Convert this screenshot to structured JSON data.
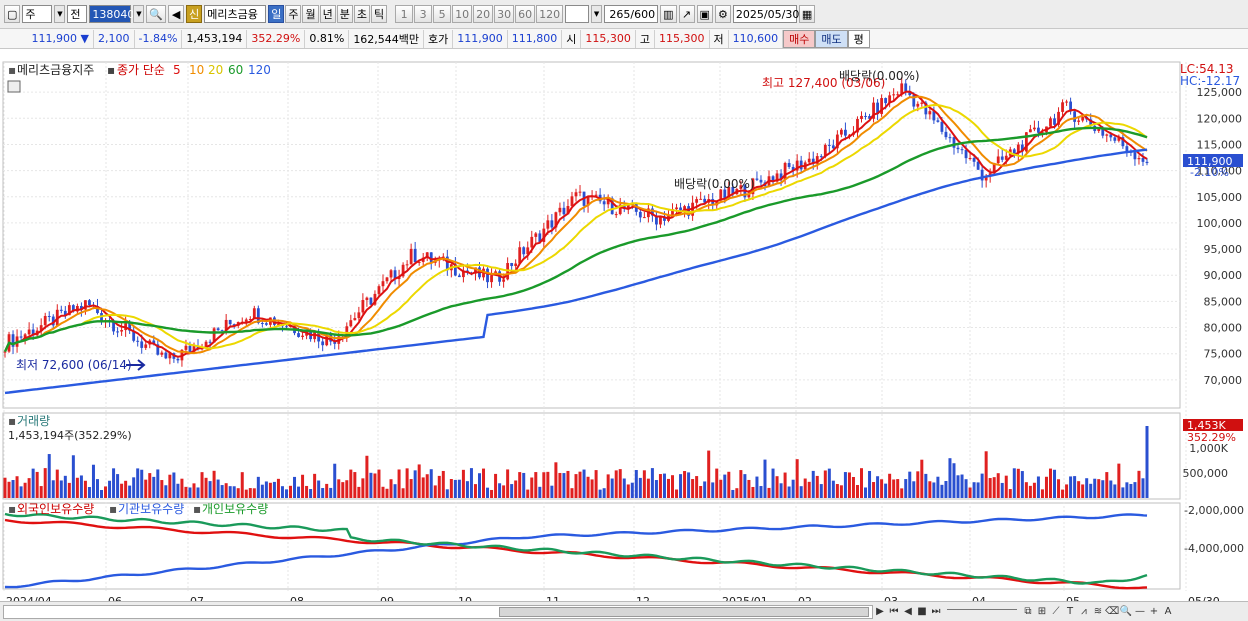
{
  "toolbar": {
    "market": "주",
    "prefix": "전",
    "code": "138040",
    "sin": "신",
    "name": "메리츠금융",
    "periods": [
      "일",
      "주",
      "월",
      "년",
      "분",
      "초",
      "틱"
    ],
    "active_period": "일",
    "intervals": [
      "1",
      "3",
      "5",
      "10",
      "20",
      "30",
      "60",
      "120"
    ],
    "count": "265",
    "max_count": "/600",
    "date": "2025/05/30"
  },
  "info": {
    "price": "111,900",
    "arrow": "▼",
    "change": "2,100",
    "change_pct": "-1.84%",
    "volume": "1,453,194",
    "vol_ratio": "352.29%",
    "turnover_ratio": "0.81%",
    "amount": "162,544백만",
    "quote_label": "호가",
    "ask": "111,900",
    "bid": "111,800",
    "open_label": "시",
    "open": "115,300",
    "high_label": "고",
    "high": "115,300",
    "low_label": "저",
    "low": "110,600",
    "buy": "매수",
    "sell": "매도",
    "avg": "평"
  },
  "chart_labels": {
    "name_tag": "메리츠금융지주",
    "ma_prefix": "종가 단순",
    "ma_periods": [
      "5",
      "10",
      "20",
      "60",
      "120"
    ],
    "ma_colors": [
      "#dd1111",
      "#f08c00",
      "#ecd800",
      "#1a9a2a",
      "#2a5ae0"
    ],
    "lc": "LC:54.13",
    "hc": "HC:-12.17",
    "price_tag": "111,900",
    "price_pct": "-2.10%",
    "high_note": "최고 127,400 (03/06)",
    "low_note": "최저 72,600 (06/14)",
    "div_note1": "배당락(0.00%)",
    "div_note2": "배당락(0.00%)",
    "vol_title": "거래량",
    "vol_value": "1,453,194주(352.29%)",
    "vol_tag": "1,453K",
    "vol_tag_pct": "352.29%",
    "holder_labels": [
      "외국인보유수량",
      "기관보유수량",
      "개인보유수량"
    ]
  },
  "chart_data": {
    "type": "line",
    "price_axis": [
      "125,000",
      "120,000",
      "115,000",
      "110,000",
      "105,000",
      "100,000",
      "95,000",
      "90,000",
      "85,000",
      "80,000",
      "75,000",
      "70,000"
    ],
    "price_range": [
      65000,
      130000
    ],
    "volume_axis": [
      "1,000K",
      "500,000"
    ],
    "holder_axis": [
      "-2,000,000",
      "-4,000,000"
    ],
    "x_labels": [
      "2024/04",
      "06",
      "07",
      "08",
      "09",
      "10",
      "11",
      "12",
      "2025/01",
      "02",
      "03",
      "04",
      "05",
      "05/30"
    ],
    "close_points": [
      [
        "2024/04",
        77000
      ],
      [
        "2024/05",
        84500
      ],
      [
        "2024/06",
        73500
      ],
      [
        "2024/07",
        83000
      ],
      [
        "2024/08",
        77500
      ],
      [
        "2024/09",
        94000
      ],
      [
        "2024/10",
        89000
      ],
      [
        "2024/11",
        105000
      ],
      [
        "2024/12",
        101000
      ],
      [
        "2025/01",
        106000
      ],
      [
        "2025/02",
        113000
      ],
      [
        "2025/03",
        126000
      ],
      [
        "2025/04",
        109000
      ],
      [
        "2025/05",
        122000
      ],
      [
        "2025/05/30",
        111900
      ]
    ],
    "series": [
      {
        "name": "5",
        "color": "#dd1111"
      },
      {
        "name": "10",
        "color": "#f08c00"
      },
      {
        "name": "20",
        "color": "#ecd800"
      },
      {
        "name": "60",
        "color": "#1a9a2a"
      },
      {
        "name": "120",
        "color": "#2a5ae0"
      }
    ]
  },
  "bottom": {
    "nav": [
      "▶",
      "|◀◀",
      "◀",
      "■",
      "▶▶"
    ]
  }
}
